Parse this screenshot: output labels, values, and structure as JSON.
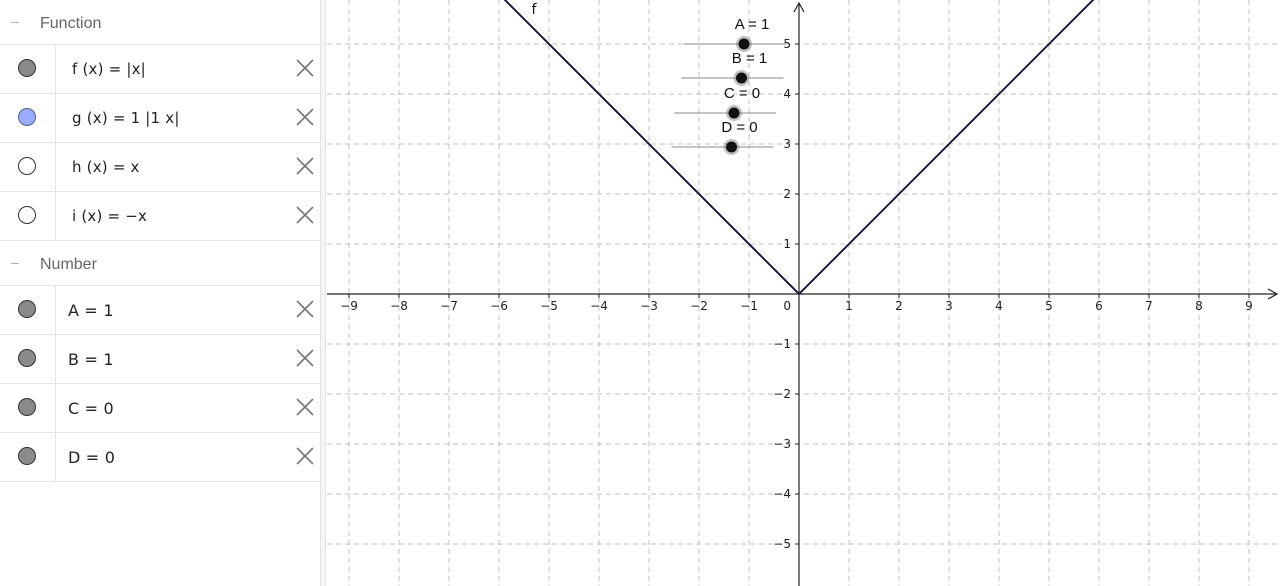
{
  "algebra": {
    "groups": [
      {
        "title": "Function",
        "items": [
          {
            "marble": "gray",
            "expr": "f (x)  =  |x|"
          },
          {
            "marble": "blue",
            "expr": "g (x)  =  1  |1 x|"
          },
          {
            "marble": "white",
            "expr": "h (x)  =  x"
          },
          {
            "marble": "white",
            "expr": "i (x)  =  −x"
          }
        ]
      },
      {
        "title": "Number",
        "items": [
          {
            "marble": "gray",
            "expr": "A  =  1"
          },
          {
            "marble": "gray",
            "expr": "B  =  1"
          },
          {
            "marble": "gray",
            "expr": "C  =  0"
          },
          {
            "marble": "gray",
            "expr": "D  =  0"
          }
        ]
      }
    ]
  },
  "graph": {
    "x_tick_labels": [
      "−9",
      "−8",
      "−7",
      "−6",
      "−5",
      "−4",
      "−3",
      "−2",
      "−1",
      "1",
      "2",
      "3",
      "4",
      "5",
      "6",
      "7",
      "8",
      "9"
    ],
    "y_tick_labels": [
      "5",
      "4",
      "3",
      "2",
      "1",
      "−1",
      "−2",
      "−3",
      "−4",
      "−5"
    ],
    "origin_label": "0",
    "curve_label": "f",
    "curve_color": "#1a1a3a",
    "sliders": [
      {
        "label": "A = 1",
        "value": 1
      },
      {
        "label": "B = 1",
        "value": 1
      },
      {
        "label": "C = 0",
        "value": 0
      },
      {
        "label": "D = 0",
        "value": 0
      }
    ]
  },
  "colors": {
    "marble_gray": "#8a8a8a",
    "marble_blue": "#99aaff",
    "grid": "#c0c0c0"
  }
}
